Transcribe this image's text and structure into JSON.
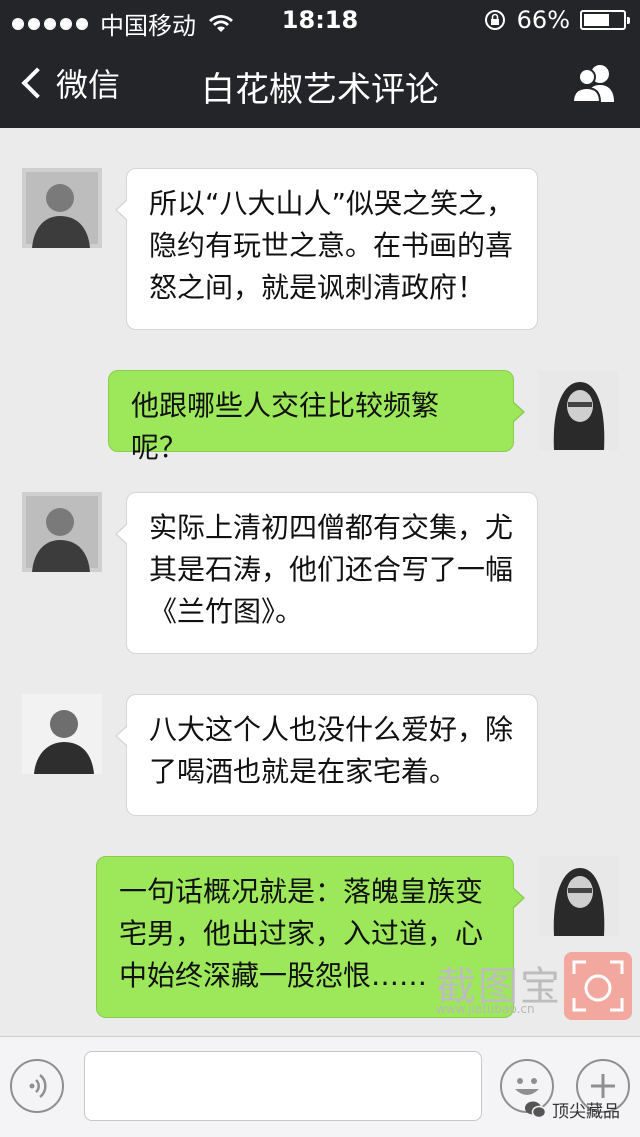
{
  "status_bar": {
    "carrier": "中国移动",
    "time": "18:18",
    "battery": "66%",
    "battery_level": 0.66
  },
  "nav": {
    "back_label": "微信",
    "title": "白花椒艺术评论"
  },
  "messages": [
    {
      "side": "left",
      "text": "所以“八大山人”似哭之笑之，隐约有玩世之意。在书画的喜怒之间，就是讽刺清政府！"
    },
    {
      "side": "right",
      "text": "他跟哪些人交往比较频繁呢？"
    },
    {
      "side": "left",
      "text": "实际上清初四僧都有交集，尤其是石涛，他们还合写了一幅《兰竹图》。"
    },
    {
      "side": "left",
      "text": "八大这个人也没什么爱好，除了喝酒也就是在家宅着。"
    },
    {
      "side": "right",
      "text": "一句话概况就是：落魄皇族变宅男，他出过家，入过道，心中始终深藏一股怨恨……"
    }
  ],
  "watermark": {
    "text": "截图宝",
    "url": "www.jietubao.cn"
  },
  "bottom_bar": {
    "brand": "顶尖藏品"
  },
  "icons": {
    "wifi": "wifi-icon",
    "lock": "rotation-lock-icon",
    "back": "chevron-left-icon",
    "contact": "contacts-icon",
    "voice": "voice-icon",
    "emoji": "emoji-icon",
    "plus": "plus-icon",
    "brand": "wechat-icon"
  }
}
